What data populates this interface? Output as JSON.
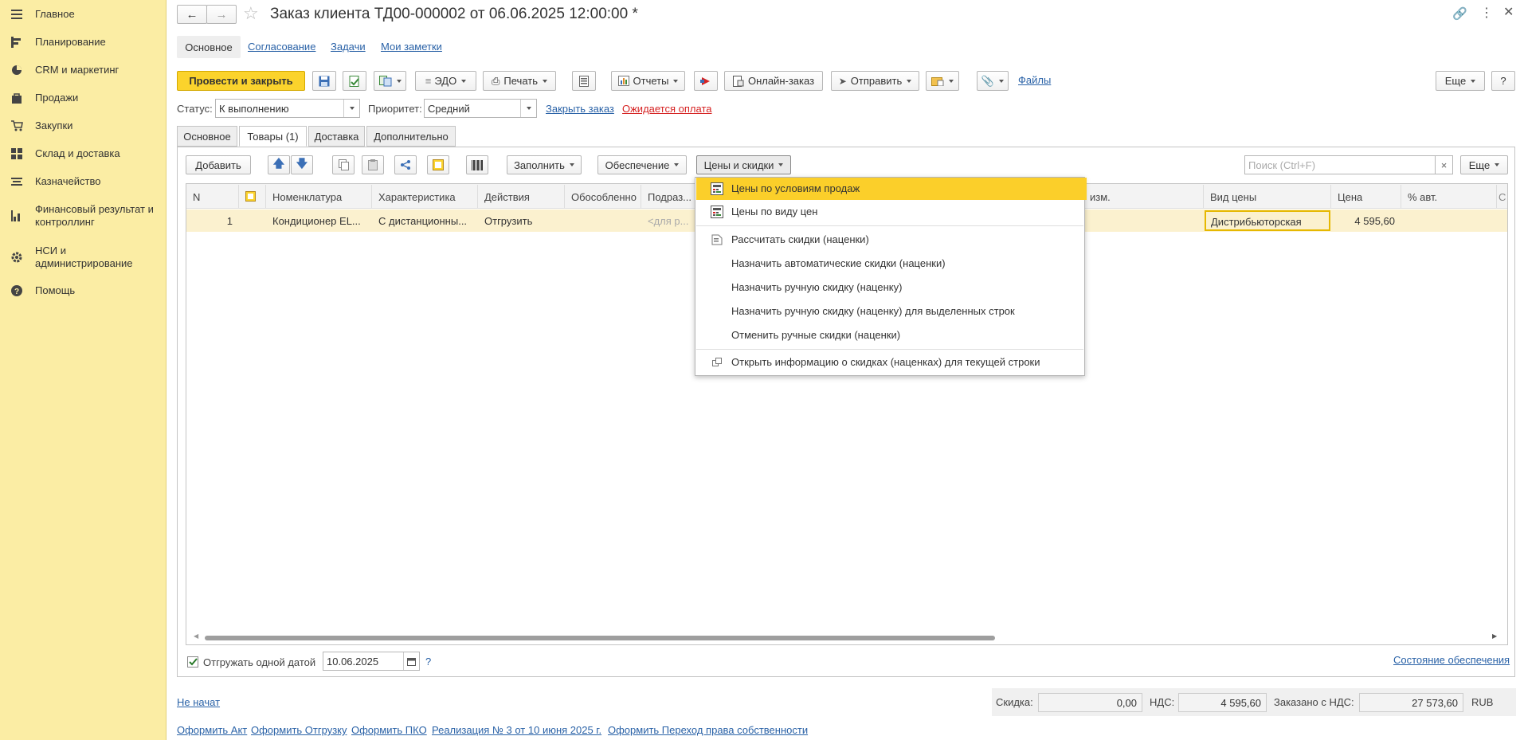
{
  "sidebar": {
    "items": [
      {
        "label": "Главное",
        "icon": "menu-icon"
      },
      {
        "label": "Планирование",
        "icon": "planning-icon"
      },
      {
        "label": "CRM и маркетинг",
        "icon": "pie-chart-icon"
      },
      {
        "label": "Продажи",
        "icon": "bag-icon"
      },
      {
        "label": "Закупки",
        "icon": "cart-icon"
      },
      {
        "label": "Склад и доставка",
        "icon": "warehouse-icon"
      },
      {
        "label": "Казначейство",
        "icon": "treasury-icon"
      },
      {
        "label": "Финансовый результат и контроллинг",
        "icon": "bar-chart-icon"
      },
      {
        "label": "НСИ и администрирование",
        "icon": "gear-icon"
      },
      {
        "label": "Помощь",
        "icon": "help-icon"
      }
    ]
  },
  "header": {
    "title": "Заказ клиента ТД00-000002 от 06.06.2025 12:00:00 *"
  },
  "nav_tabs": {
    "main": "Основное",
    "approval": "Согласование",
    "tasks": "Задачи",
    "notes": "Мои заметки"
  },
  "toolbar": {
    "post_close": "Провести и закрыть",
    "edo": "ЭДО",
    "print": "Печать",
    "reports": "Отчеты",
    "online_order": "Онлайн-заказ",
    "send": "Отправить",
    "files": "Файлы",
    "more": "Еще",
    "help": "?"
  },
  "status_row": {
    "status_label": "Статус:",
    "status_value": "К выполнению",
    "priority_label": "Приоритет:",
    "priority_value": "Средний",
    "close_order": "Закрыть заказ",
    "awaiting_payment": "Ожидается оплата"
  },
  "doc_tabs": {
    "main": "Основное",
    "goods": "Товары (1)",
    "delivery": "Доставка",
    "extra": "Дополнительно"
  },
  "table_toolbar": {
    "add": "Добавить",
    "fill": "Заполнить",
    "supply": "Обеспечение",
    "prices": "Цены и скидки",
    "search_placeholder": "Поиск (Ctrl+F)",
    "clear": "×",
    "more": "Еще"
  },
  "table": {
    "columns": [
      "N",
      "",
      "Номенклатура",
      "Характеристика",
      "Действия",
      "Обособленно",
      "Подраз...",
      "изм.",
      "Вид цены",
      "Цена",
      "% авт."
    ],
    "rows": [
      {
        "n": "1",
        "nomenclature": "Кондиционер EL...",
        "characteristic": "С дистанционны...",
        "action": "Отгрузить",
        "separate": "",
        "division": "<для р...",
        "unit": "",
        "price_type": "Дистрибьюторская",
        "price": "4 595,60",
        "auto": ""
      }
    ]
  },
  "prices_menu": {
    "items": [
      {
        "label": "Цены по условиям продаж",
        "icon": "calc-icon"
      },
      {
        "label": "Цены по виду цен",
        "icon": "calc-icon"
      },
      {
        "label": "Рассчитать скидки (наценки)",
        "icon": "discount-icon"
      },
      {
        "label": "Назначить автоматические скидки (наценки)",
        "icon": ""
      },
      {
        "label": "Назначить ручную скидку (наценку)",
        "icon": ""
      },
      {
        "label": "Назначить ручную скидку (наценку) для выделенных строк",
        "icon": ""
      },
      {
        "label": "Отменить ручные скидки (наценки)",
        "icon": ""
      },
      {
        "label": "Открыть информацию о скидках (наценках) для текущей строки",
        "icon": "open-link-icon"
      }
    ]
  },
  "shipment": {
    "checkbox_label": "Отгружать одной датой",
    "date": "10.06.2025",
    "help": "?",
    "supply_state": "Состояние обеспечения"
  },
  "footer": {
    "not_started": "Не начат",
    "discount_label": "Скидка:",
    "discount_value": "0,00",
    "vat_label": "НДС:",
    "vat_value": "4 595,60",
    "ordered_label": "Заказано с НДС:",
    "ordered_value": "27 573,60",
    "currency": "RUB",
    "links": [
      "Оформить Акт",
      "Оформить Отгрузку",
      "Оформить ПКО",
      "Реализация № 3 от 10 июня 2025 г.",
      "Оформить Переход права собственности"
    ]
  },
  "colors": {
    "sidebar_bg": "#fbeda4",
    "accent_yellow": "#fbd32c",
    "link": "#2a62a7",
    "warning": "#d62323"
  }
}
